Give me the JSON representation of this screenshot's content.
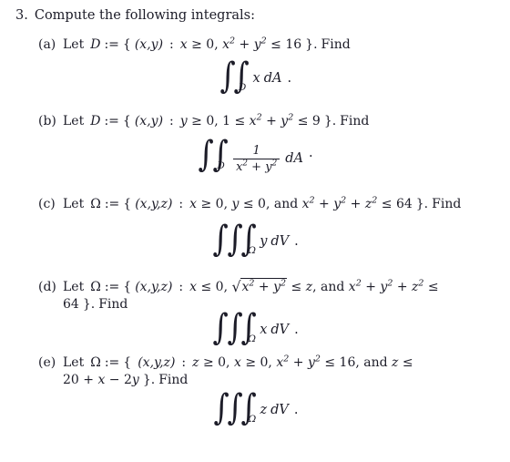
{
  "document": {
    "kind": "math-exercise",
    "background_color": "#ffffff",
    "text_color": "#1c1c28"
  },
  "problem": {
    "number": "3.",
    "prompt": "Compute the following integrals:"
  },
  "items": [
    {
      "label": "(a)",
      "lead": "Let",
      "set_name": "D",
      "defsym": ":=",
      "open": "{",
      "tuple": "(x, y)",
      "colon": ":",
      "conditions": "x ≥ 0,  x² + y² ≤ 16",
      "close": "}.",
      "find": "Find",
      "continuation": "",
      "integral": {
        "order": 2,
        "sub": "D",
        "integrand": "x dA",
        "measure": "dA",
        "variable": "x",
        "terminator": "."
      }
    },
    {
      "label": "(b)",
      "lead": "Let",
      "set_name": "D",
      "defsym": ":=",
      "open": "{",
      "tuple": "(x, y)",
      "colon": ":",
      "conditions": "y ≥ 0, 1 ≤ x² + y² ≤ 9",
      "close": "}.",
      "find": "Find",
      "continuation": "",
      "integral": {
        "order": 2,
        "sub": "D",
        "integrand": "1/(x² + y²) dA",
        "measure": "dA",
        "fraction_numerator": "1",
        "fraction_denominator": "x² + y²",
        "terminator": "."
      }
    },
    {
      "label": "(c)",
      "lead": "Let",
      "set_name": "Ω",
      "defsym": ":=",
      "open": "{",
      "tuple": "(x, y, z)",
      "colon": ":",
      "conditions": "x ≥ 0,  y ≤ 0,  and x² + y² + z² ≤ 64",
      "close": "}.",
      "find": "Find",
      "continuation": "",
      "integral": {
        "order": 3,
        "sub": "Ω",
        "integrand": "y dV",
        "measure": "dV",
        "variable": "y",
        "terminator": "."
      }
    },
    {
      "label": "(d)",
      "lead": "Let",
      "set_name": "Ω",
      "defsym": ":=",
      "open": "{",
      "tuple": "(x, y, z)",
      "colon": ":",
      "conditions": "x ≤ 0,  √(x² + y²) ≤ z,  and x² + y² + z² ≤",
      "close": "}.",
      "find": "Find",
      "continuation": "64 }. Find",
      "continuation_value": "64",
      "integral": {
        "order": 3,
        "sub": "Ω",
        "integrand": "x dV",
        "measure": "dV",
        "variable": "x",
        "terminator": "."
      }
    },
    {
      "label": "(e)",
      "lead": "Let",
      "set_name": "Ω",
      "defsym": ":=",
      "open": "{",
      "tuple": "(x, y, z)",
      "colon": ":",
      "conditions": "z ≥ 0,  x ≥ 0,  x² + y² ≤ 16,  and z ≤",
      "close": "}.",
      "find": "Find",
      "continuation": "20 + x − 2y }. Find",
      "continuation_value": "20 + x − 2y",
      "integral": {
        "order": 3,
        "sub": "Ω",
        "integrand": "z dV",
        "measure": "dV",
        "variable": "z",
        "terminator": "."
      }
    }
  ],
  "glyphs": {
    "integral": "∫",
    "geq": "≥",
    "leq": "≤",
    "radical": "√",
    "omega": "Ω",
    "minus": "−",
    "plus": "+"
  }
}
